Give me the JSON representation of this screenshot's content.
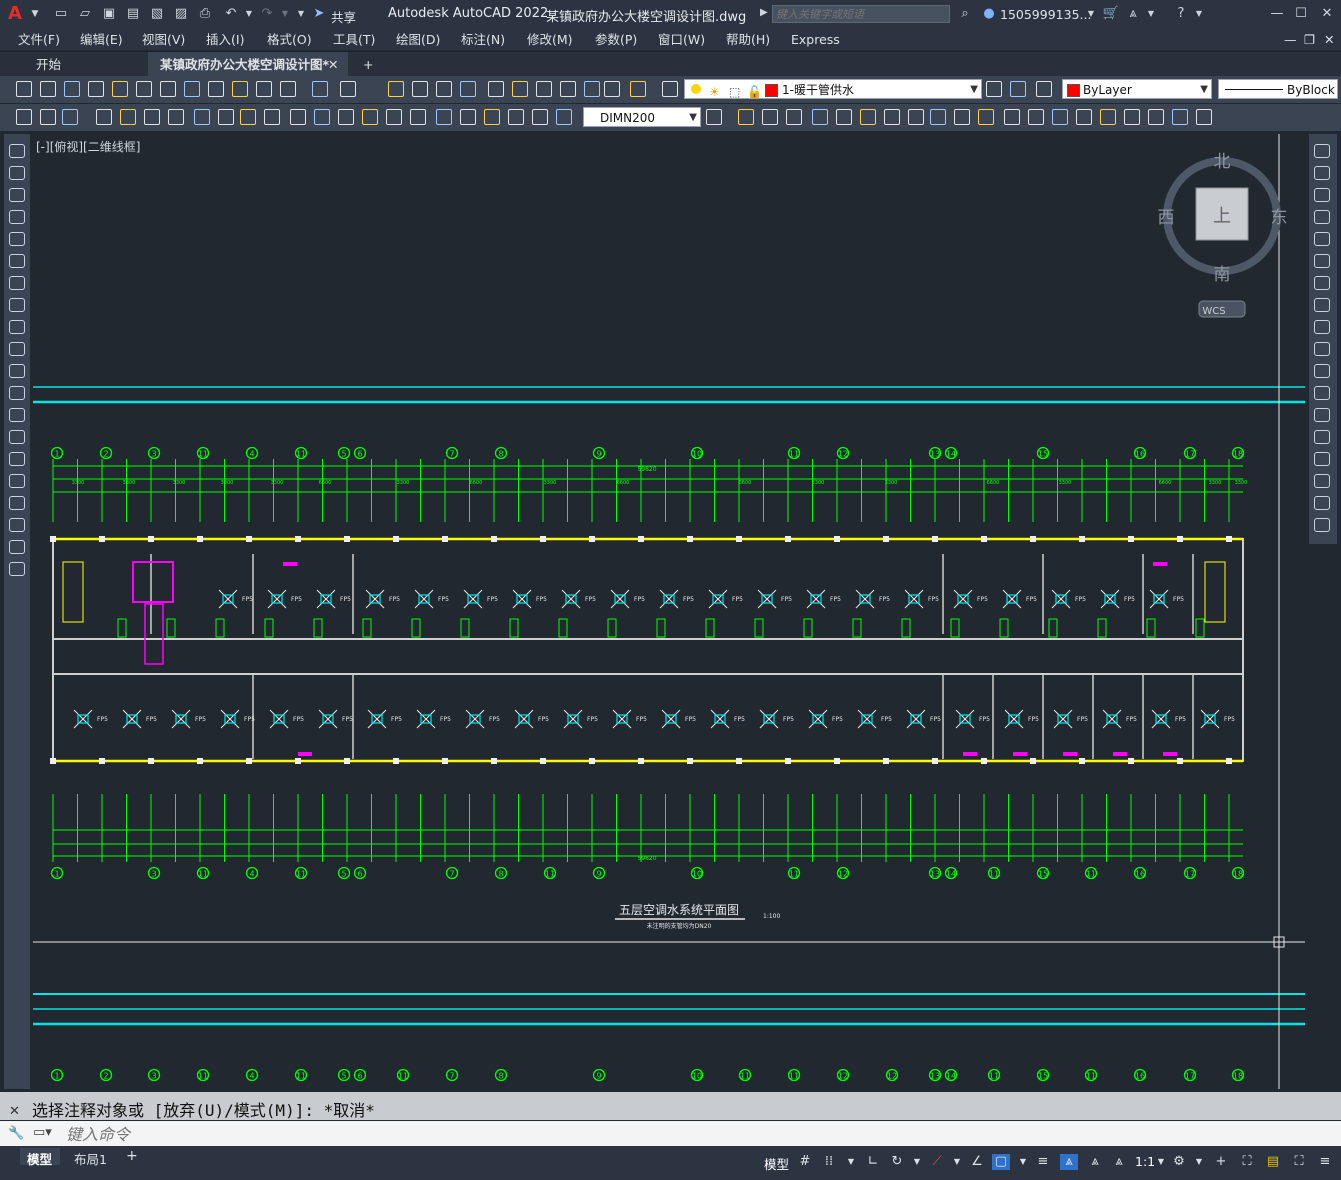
{
  "title_bar": {
    "app_title": "Autodesk AutoCAD 2022",
    "file_name": "某镇政府办公大楼空调设计图.dwg",
    "share_label": "共享",
    "search_placeholder": "键入关键字或短语",
    "user": "1505999135...",
    "app_letter": "A"
  },
  "menu": [
    "文件(F)",
    "编辑(E)",
    "视图(V)",
    "插入(I)",
    "格式(O)",
    "工具(T)",
    "绘图(D)",
    "标注(N)",
    "修改(M)",
    "参数(P)",
    "窗口(W)",
    "帮助(H)",
    "Express"
  ],
  "tabs": {
    "start": "开始",
    "active": "某镇政府办公大楼空调设计图*",
    "add": "+"
  },
  "toolbar": {
    "layer": "1-暖干管供水",
    "color": "ByLayer",
    "linetype": "ByBlock",
    "dimstyle": "DIMN200"
  },
  "viewport_label": "[-][俯视][二维线框]",
  "viewcube": {
    "north": "北",
    "south": "南",
    "west": "西",
    "east": "东",
    "face": "上",
    "wcs": "WCS"
  },
  "drawing": {
    "title": "五层空调水系统平面图",
    "scale": "1:100",
    "note": "未注明的支管均为DN20",
    "top_axes": [
      "1",
      "2",
      "3",
      "11",
      "4",
      "11",
      "5",
      "6",
      "7",
      "8",
      "9",
      "10",
      "11",
      "12",
      "13",
      "14",
      "15",
      "16",
      "17",
      "18"
    ],
    "bottom_axes": [
      "1",
      "3",
      "11",
      "4",
      "11",
      "5",
      "6",
      "7",
      "8",
      "11",
      "9",
      "10",
      "11",
      "12",
      "13",
      "14",
      "11",
      "15",
      "11",
      "16",
      "17",
      "18"
    ],
    "lower_axes": [
      "1",
      "2",
      "3",
      "11",
      "4",
      "11",
      "5",
      "6",
      "11",
      "7",
      "8",
      "9",
      "10",
      "11",
      "11",
      "12",
      "12",
      "13",
      "14",
      "11",
      "15",
      "11",
      "16",
      "17",
      "18"
    ],
    "equip_label": "FP5",
    "top_dims": [
      "3300",
      "3300",
      "3300",
      "3300",
      "3300",
      "6600",
      "3300",
      "6600",
      "3300",
      "6600",
      "6600",
      "3300",
      "3300",
      "6600",
      "3300",
      "6600",
      "3300",
      "3300"
    ],
    "total_dim": "59820"
  },
  "command": {
    "history": "选择注释对象或 [放弃(U)/模式(M)]: *取消*",
    "placeholder": "键入命令"
  },
  "status": {
    "model_tab": "模型",
    "layout_tab": "布局1",
    "model_btn": "模型",
    "scale": "1:1"
  },
  "colors": {
    "green": "#00ff00",
    "cyan": "#00e5e5",
    "yellow": "#ffff00",
    "magenta": "#ff00ff",
    "bg": "#212830"
  }
}
